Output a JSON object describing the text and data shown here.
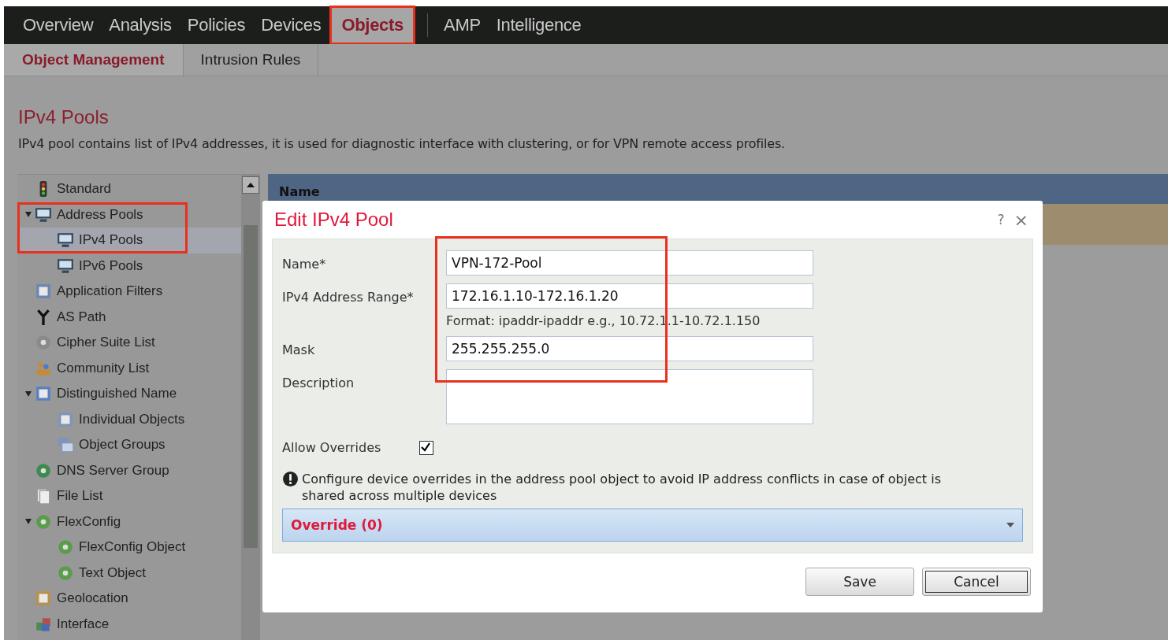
{
  "nav": {
    "items": [
      {
        "label": "Overview",
        "selected": false,
        "highlighted": false
      },
      {
        "label": "Analysis",
        "selected": false,
        "highlighted": false
      },
      {
        "label": "Policies",
        "selected": false,
        "highlighted": false
      },
      {
        "label": "Devices",
        "selected": false,
        "highlighted": false
      },
      {
        "label": "Objects",
        "selected": true,
        "highlighted": true
      },
      {
        "label": "AMP",
        "selected": false,
        "highlighted": false
      },
      {
        "label": "Intelligence",
        "selected": false,
        "highlighted": false
      }
    ]
  },
  "subnav": {
    "tabs": [
      {
        "label": "Object Management",
        "selected": true
      },
      {
        "label": "Intrusion Rules",
        "selected": false
      }
    ]
  },
  "page": {
    "title": "IPv4 Pools",
    "description": "IPv4 pool contains list of IPv4 addresses, it is used for diagnostic interface with clustering, or for VPN remote access profiles."
  },
  "sidebar": {
    "items": [
      {
        "label": "Standard",
        "selected": false,
        "highlighted": false
      },
      {
        "label": "Address Pools",
        "selected": false,
        "highlighted": true,
        "expanded": true,
        "children": [
          {
            "label": "IPv4 Pools",
            "selected": true,
            "highlighted": true
          },
          {
            "label": "IPv6 Pools",
            "selected": false,
            "highlighted": false
          }
        ]
      },
      {
        "label": "Application Filters",
        "selected": false,
        "highlighted": false
      },
      {
        "label": "AS Path",
        "selected": false,
        "highlighted": false
      },
      {
        "label": "Cipher Suite List",
        "selected": false,
        "highlighted": false
      },
      {
        "label": "Community List",
        "selected": false,
        "highlighted": false
      },
      {
        "label": "Distinguished Name",
        "selected": false,
        "highlighted": false,
        "expanded": true,
        "children": [
          {
            "label": "Individual Objects",
            "selected": false,
            "highlighted": false
          },
          {
            "label": "Object Groups",
            "selected": false,
            "highlighted": false
          }
        ]
      },
      {
        "label": "DNS Server Group",
        "selected": false,
        "highlighted": false
      },
      {
        "label": "File List",
        "selected": false,
        "highlighted": false
      },
      {
        "label": "FlexConfig",
        "selected": false,
        "highlighted": false,
        "expanded": true,
        "children": [
          {
            "label": "FlexConfig Object",
            "selected": false,
            "highlighted": false
          },
          {
            "label": "Text Object",
            "selected": false,
            "highlighted": false
          }
        ]
      },
      {
        "label": "Geolocation",
        "selected": false,
        "highlighted": false
      },
      {
        "label": "Interface",
        "selected": false,
        "highlighted": false
      }
    ]
  },
  "table": {
    "columns": [
      "Name"
    ]
  },
  "dialog": {
    "title": "Edit IPv4 Pool",
    "help": "?",
    "close": "×",
    "fields_highlighted": true,
    "fields": [
      {
        "label": "Name*",
        "value": "VPN-172-Pool"
      },
      {
        "label": "IPv4 Address Range*",
        "value": "172.16.1.10-172.16.1.20",
        "hint": "Format: ipaddr-ipaddr e.g., 10.72.1.1-10.72.1.150"
      },
      {
        "label": "Mask",
        "value": "255.255.255.0"
      }
    ],
    "description": {
      "label": "Description"
    },
    "allow_overrides": {
      "label": "Allow Overrides",
      "checked": true
    },
    "notice": "Configure device overrides in the address pool object to avoid IP address conflicts in case of object is shared across multiple devices",
    "override": {
      "label": "Override (0)",
      "expanded": false
    },
    "buttons": [
      "Save",
      "Cancel"
    ]
  }
}
